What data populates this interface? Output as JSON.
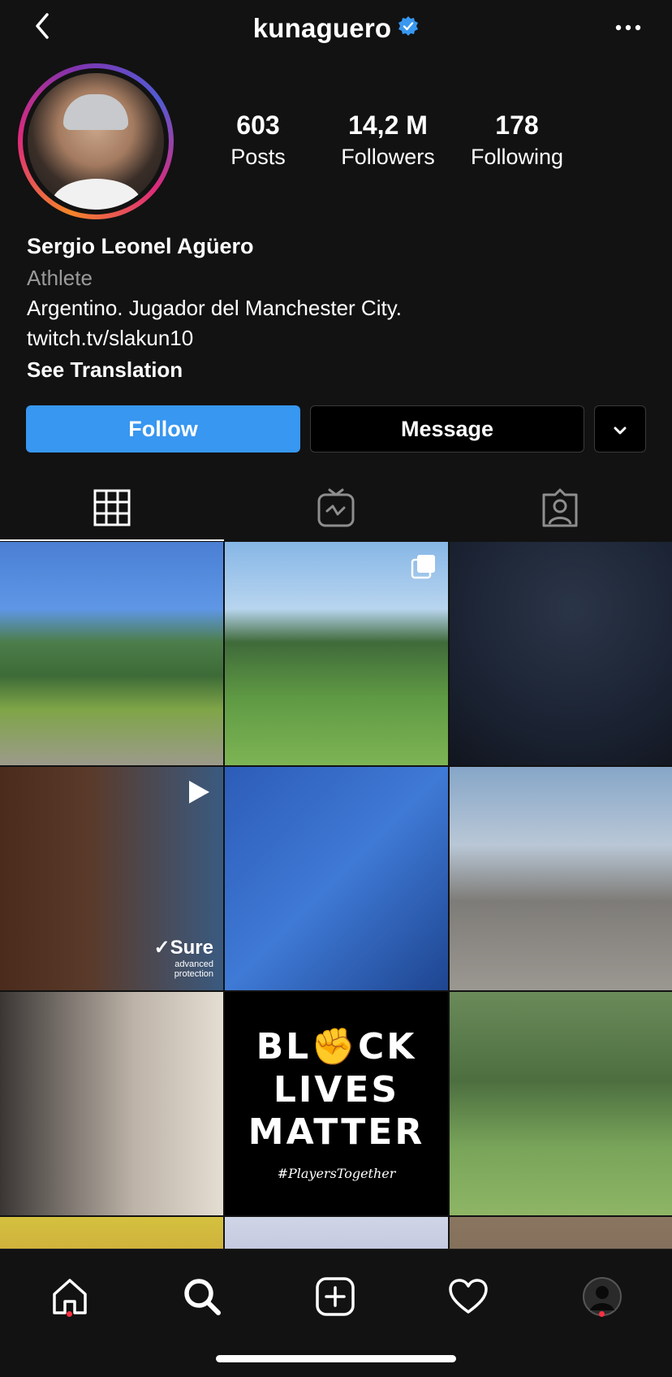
{
  "header": {
    "username": "kunaguero",
    "verified": true
  },
  "profile": {
    "stats": [
      {
        "value": "603",
        "label": "Posts"
      },
      {
        "value": "14,2 M",
        "label": "Followers"
      },
      {
        "value": "178",
        "label": "Following"
      }
    ],
    "name": "Sergio Leonel Agüero",
    "category": "Athlete",
    "bio": "Argentino. Jugador del Manchester City.",
    "link": "twitch.tv/slakun10",
    "see_translation": "See Translation"
  },
  "actions": {
    "follow": "Follow",
    "message": "Message"
  },
  "tabs": [
    {
      "name": "grid-icon",
      "active": true
    },
    {
      "name": "igtv-icon",
      "active": false
    },
    {
      "name": "tagged-icon",
      "active": false
    }
  ],
  "posts": {
    "blm_line1": "BL✊CK",
    "blm_line2": "LIVES",
    "blm_line3": "MATTER",
    "blm_tag": "#PlayersTogether",
    "sure_brand": "✓Sure",
    "sure_sub1": "advanced",
    "sure_sub2": "protection"
  },
  "bottom_nav": [
    {
      "name": "home-icon",
      "badge": true
    },
    {
      "name": "search-icon",
      "badge": false
    },
    {
      "name": "new-post-icon",
      "badge": false
    },
    {
      "name": "activity-icon",
      "badge": false
    },
    {
      "name": "profile-avatar",
      "badge": true
    }
  ],
  "colors": {
    "background": "#121212",
    "follow_button": "#3897f0",
    "verified": "#3897f0",
    "notification_dot": "#ff3040"
  }
}
